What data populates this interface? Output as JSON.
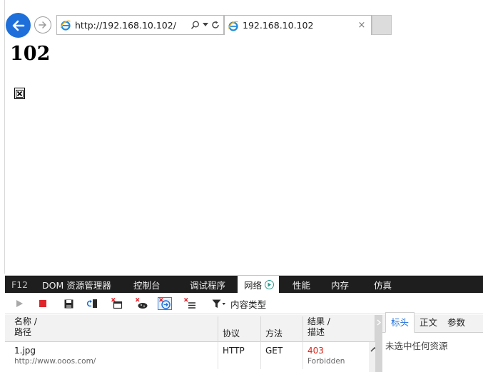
{
  "browser": {
    "address_url": "http://192.168.10.102/",
    "tab_title": "192.168.10.102",
    "tab_close": "×"
  },
  "page": {
    "heading": "102"
  },
  "devtools": {
    "tabs": [
      {
        "label": "F12"
      },
      {
        "label": "DOM 资源管理器"
      },
      {
        "label": "控制台"
      },
      {
        "label": "调试程序"
      },
      {
        "label": "网络"
      },
      {
        "label": "性能"
      },
      {
        "label": "内存"
      },
      {
        "label": "仿真"
      }
    ],
    "active_tab": "网络",
    "filter_label": "内容类型",
    "columns": {
      "name_line1": "名称 /",
      "name_line2": "路径",
      "protocol": "协议",
      "method": "方法",
      "result_line1": "结果 /",
      "result_line2": "描述"
    },
    "rows": [
      {
        "name": "1.jpg",
        "path": "http://www.ooos.com/",
        "protocol": "HTTP",
        "method": "GET",
        "status": "403",
        "status_text": "Forbidden"
      }
    ],
    "detail": {
      "tabs": [
        "标头",
        "正文",
        "参数"
      ],
      "active": "标头",
      "empty_message": "未选中任何资源"
    },
    "colors": {
      "accent": "#1e6fd9",
      "status_error": "#d9261c",
      "tab_bar": "#1e1e1e"
    }
  }
}
